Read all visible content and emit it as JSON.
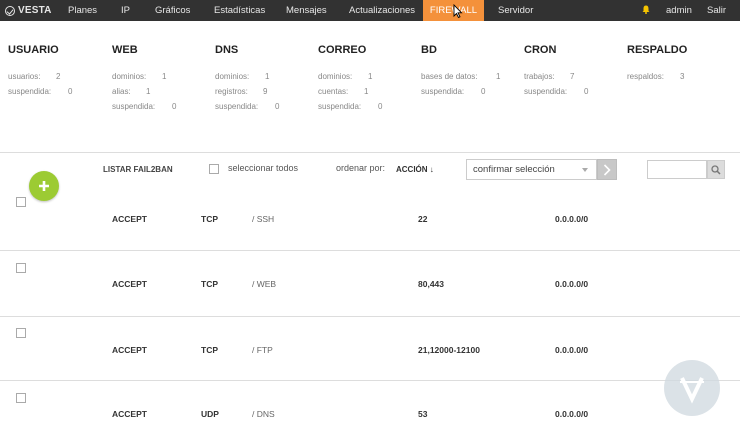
{
  "nav": {
    "logo": "VESTA",
    "items": [
      "Planes",
      "IP",
      "Gráficos",
      "Estadísticas",
      "Mensajes",
      "Actualizaciones",
      "FIREWALL",
      "Servidor"
    ],
    "active_index": 6,
    "user": "admin",
    "logout": "Salir",
    "accent_color": "#f4913b"
  },
  "stats": [
    {
      "title": "USUARIO",
      "rows": [
        {
          "label": "usuarios:",
          "value": "2"
        },
        {
          "label": "suspendida:",
          "value": "0"
        }
      ]
    },
    {
      "title": "WEB",
      "rows": [
        {
          "label": "dominios:",
          "value": "1"
        },
        {
          "label": "alias:",
          "value": "1"
        },
        {
          "label": "suspendida:",
          "value": "0"
        }
      ]
    },
    {
      "title": "DNS",
      "rows": [
        {
          "label": "dominios:",
          "value": "1"
        },
        {
          "label": "registros:",
          "value": "9"
        },
        {
          "label": "suspendida:",
          "value": "0"
        }
      ]
    },
    {
      "title": "CORREO",
      "rows": [
        {
          "label": "dominios:",
          "value": "1"
        },
        {
          "label": "cuentas:",
          "value": "1"
        },
        {
          "label": "suspendida:",
          "value": "0"
        }
      ]
    },
    {
      "title": "BD",
      "rows": [
        {
          "label": "bases de datos:",
          "value": "1"
        },
        {
          "label": "suspendida:",
          "value": "0"
        }
      ]
    },
    {
      "title": "CRON",
      "rows": [
        {
          "label": "trabajos:",
          "value": "7"
        },
        {
          "label": "suspendida:",
          "value": "0"
        }
      ]
    },
    {
      "title": "RESPALDO",
      "rows": [
        {
          "label": "respaldos:",
          "value": "3"
        }
      ]
    }
  ],
  "toolbar": {
    "list_fail2ban": "LISTAR FAIL2BAN",
    "select_all": "seleccionar todos",
    "order_by": "ordenar por:",
    "order_value": "ACCIÓN ↓",
    "dropdown_selected": "confirmar selección",
    "search_placeholder": ""
  },
  "rules": [
    {
      "action": "ACCEPT",
      "protocol": "TCP",
      "service": "/ SSH",
      "port": "22",
      "ip": "0.0.0.0/0"
    },
    {
      "action": "ACCEPT",
      "protocol": "TCP",
      "service": "/ WEB",
      "port": "80,443",
      "ip": "0.0.0.0/0"
    },
    {
      "action": "ACCEPT",
      "protocol": "TCP",
      "service": "/ FTP",
      "port": "21,12000-12100",
      "ip": "0.0.0.0/0"
    },
    {
      "action": "ACCEPT",
      "protocol": "UDP",
      "service": "/ DNS",
      "port": "53",
      "ip": "0.0.0.0/0"
    }
  ]
}
